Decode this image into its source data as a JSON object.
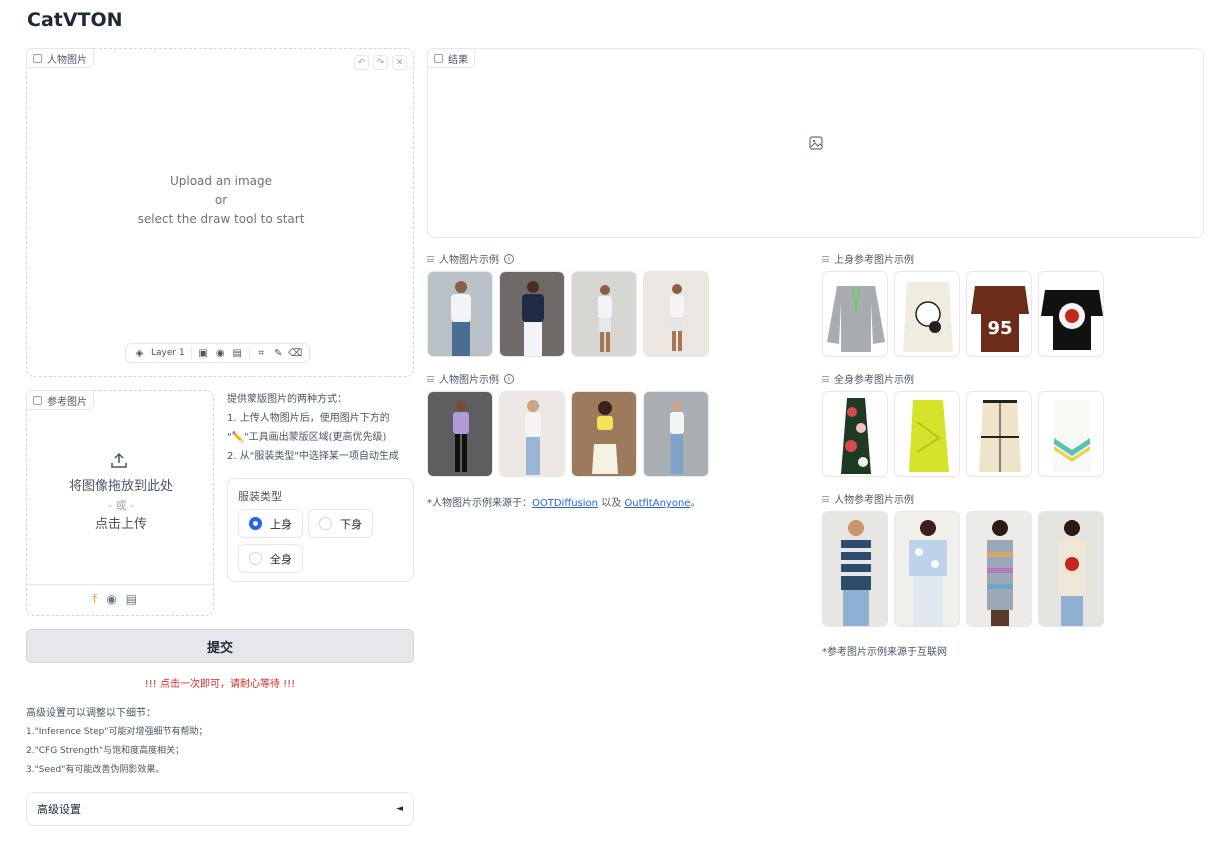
{
  "app": {
    "title": "CatVTON"
  },
  "person_image": {
    "label": "人物图片",
    "prompt_line1": "Upload an image",
    "prompt_line2": "or",
    "prompt_line3": "select the draw tool to start",
    "layer_label": "Layer 1"
  },
  "result": {
    "label": "结果"
  },
  "reference_image": {
    "label": "参考图片",
    "drop_text": "将图像拖放到此处",
    "or_text": "- 或 -",
    "click_text": "点击上传"
  },
  "mask_hint": {
    "title": "提供蒙版图片的两种方式：",
    "line1": "1. 上传人物图片后，使用图片下方的",
    "line2": "\"✏️\"工具画出蒙版区域(更高优先级)",
    "line3": "2. 从\"服装类型\"中选择某一项自动生成"
  },
  "cloth_type": {
    "label": "服装类型",
    "options": [
      "上身",
      "下身",
      "全身"
    ],
    "selected": "上身"
  },
  "submit": {
    "label": "提交",
    "warning": "!!! 点击一次即可，请耐心等待 !!!"
  },
  "advanced_notes": {
    "title": "高级设置可以调整以下细节：",
    "line1": "1.\"Inference Step\"可能对增强细节有帮助；",
    "line2": "2.\"CFG Strength\"与饱和度高度相关；",
    "line3": "3.\"Seed\"有可能改善伪阴影效果。"
  },
  "advanced_settings": {
    "label": "高级设置",
    "arrow": "◄"
  },
  "examples": {
    "person_1": {
      "label": "人物图片示例",
      "info": "i"
    },
    "person_2": {
      "label": "人物图片示例",
      "info": "i"
    },
    "person_source_prefix": "*人物图片示例来源于：",
    "person_source_link1": "OOTDiffusion",
    "person_source_mid": " 以及 ",
    "person_source_link2": "OutfitAnyone",
    "person_source_suffix": "。",
    "upper": {
      "label": "上身参考图片示例"
    },
    "full": {
      "label": "全身参考图片示例"
    },
    "human": {
      "label": "人物参考图片示例"
    },
    "ref_source": "*参考图片示例来源于互联网"
  }
}
